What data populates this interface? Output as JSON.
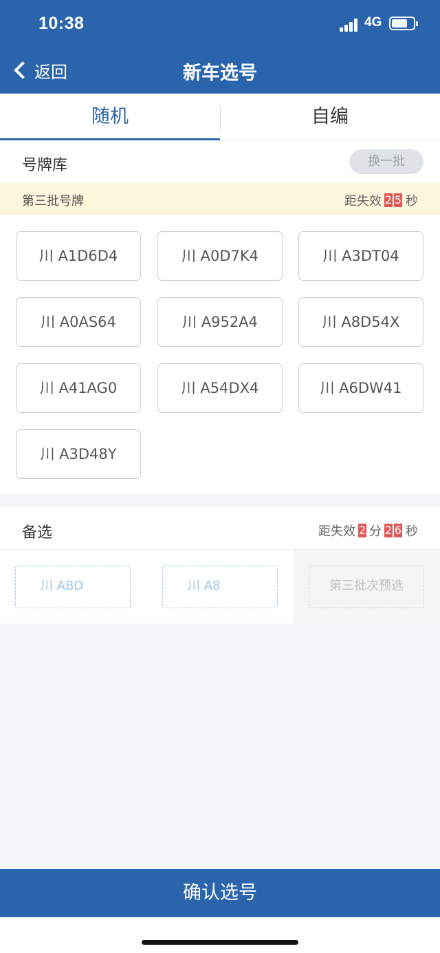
{
  "status_bar": {
    "time": "10:38",
    "network": "4G"
  },
  "nav": {
    "back_label": "返回",
    "title": "新车选号"
  },
  "tabs": [
    {
      "label": "随机",
      "active": true
    },
    {
      "label": "自编",
      "active": false
    }
  ],
  "library": {
    "title": "号牌库",
    "refresh_label": "换一批",
    "batch_name": "第三批号牌",
    "countdown": {
      "prefix": "距失效",
      "digits": [
        "2",
        "5"
      ],
      "unit": "秒"
    },
    "plates": [
      "川 A1D6D4",
      "川 A0D7K4",
      "川 A3DT04",
      "川 A0AS64",
      "川 A952A4",
      "川 A8D54X",
      "川 A41AG0",
      "川 A54DX4",
      "川 A6DW41",
      "川 A3D48Y"
    ]
  },
  "backup": {
    "title": "备选",
    "countdown": {
      "prefix": "距失效",
      "min_digit": "2",
      "min_unit": "分",
      "sec_digits": [
        "2",
        "6"
      ],
      "sec_unit": "秒"
    },
    "slots": [
      {
        "text": "川 ABD"
      },
      {
        "text": "川 A8"
      },
      {
        "text": "第三批次预选"
      }
    ]
  },
  "confirm_label": "确认选号",
  "colors": {
    "primary": "#2a64ad",
    "accent_red": "#e05757",
    "notice_bg": "#fdf5dc"
  }
}
